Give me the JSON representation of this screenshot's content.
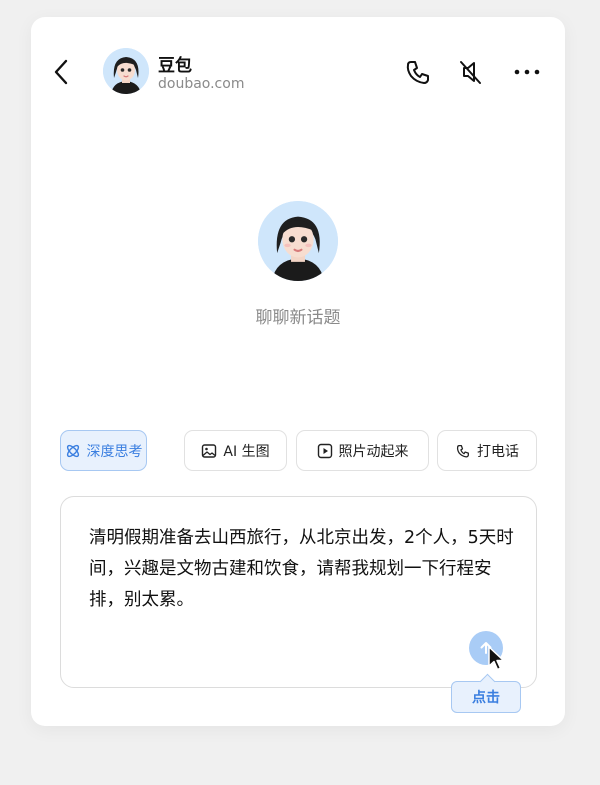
{
  "header": {
    "name": "豆包",
    "domain": "doubao.com",
    "back_icon": "chevron-left-icon",
    "phone_icon": "phone-icon",
    "mute_icon": "speaker-muted-icon",
    "more_icon": "more-horizontal-icon"
  },
  "welcome": {
    "text": "聊聊新话题"
  },
  "chips": [
    {
      "label": "深度思考",
      "icon": "atom-icon",
      "active": true
    },
    {
      "label": "AI 生图",
      "icon": "image-icon",
      "active": false
    },
    {
      "label": "照片动起来",
      "icon": "play-icon",
      "active": false
    },
    {
      "label": "打电话",
      "icon": "phone-icon",
      "active": false
    }
  ],
  "composer": {
    "text": "清明假期准备去山西旅行，从北京出发，2个人，5天时间，兴趣是文物古建和饮食，请帮我规划一下行程安排，别太累。",
    "send_icon": "arrow-up-icon"
  },
  "tooltip": {
    "text": "点击"
  },
  "colors": {
    "accent": "#3b7fe0",
    "accent_bg": "#e8f1fd",
    "send_button": "#a9ccf6",
    "page_bg": "#f0f0f0"
  }
}
